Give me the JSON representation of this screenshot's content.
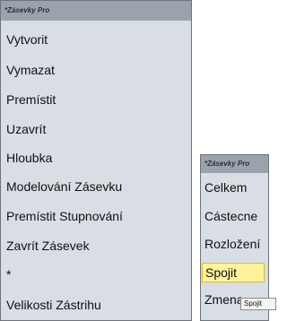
{
  "main_menu": {
    "header": "*Zásevky Pro",
    "items": [
      "Vytvorit",
      "Vymazat",
      "Premístit",
      "Uzavrít",
      "Hloubka",
      "Modelování Zásevku",
      "Premístit Stupnování",
      "Zavrít Zásevek",
      "*",
      "Velikosti Zástrihu"
    ]
  },
  "sub_menu": {
    "header": "*Zásevky Pro",
    "items": [
      "Celkem",
      "Cástecne",
      "Rozložení",
      "Spojit",
      "Zmena"
    ],
    "highlighted_index": 3
  },
  "tooltip": {
    "text": "Spojit"
  },
  "colors": {
    "menu_bg": "#d9dde4",
    "header_bg": "#9aa3ad",
    "highlight_bg": "#fff29a",
    "highlight_border": "#d7bd34"
  }
}
